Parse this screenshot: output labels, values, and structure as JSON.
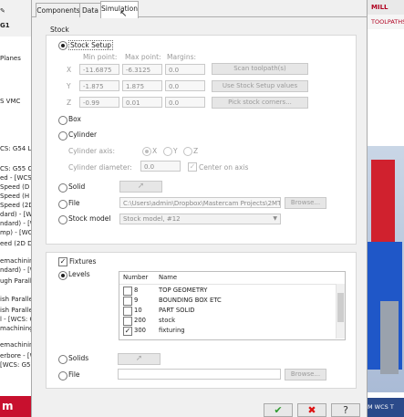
{
  "background": {
    "left_lines": [
      "Planes",
      "S VMC",
      "CS: G54 LEI",
      "CS: G55 CE",
      "ed - [WCS: G",
      "Speed (D",
      "Speed (H",
      "Speed (2D",
      "dard) - [W",
      "ndard) - [W",
      "mp) - [WCS",
      "eed (2D D",
      "emachining",
      "ndard) - [W",
      "ugh Paralle",
      "ish Paralle",
      "ish Paralle",
      "l - [WCS: G",
      "machining)",
      "emachining",
      "erbore - [W",
      "[WCS: G56"
    ],
    "left_top_label": "G1",
    "left_logo": "m",
    "right_top": "MILL",
    "right_sub": "TOOLPATHS",
    "right_bottom": "M WCS  T"
  },
  "tabs": [
    {
      "label": "Components",
      "active": false
    },
    {
      "label": "Data",
      "active": false
    },
    {
      "label": "Simulation",
      "active": true
    }
  ],
  "stock": {
    "section_title": "Stock",
    "stock_setup_label": "Stock Setup",
    "col_min": "Min point:",
    "col_max": "Max point:",
    "col_margins": "Margins:",
    "rows": [
      {
        "axis": "X",
        "min": "-11.6875",
        "max": "-6.3125",
        "margin": "0.0"
      },
      {
        "axis": "Y",
        "min": "-1.875",
        "max": "1.875",
        "margin": "0.0"
      },
      {
        "axis": "Z",
        "min": "-0.99",
        "max": "0.01",
        "margin": "0.0"
      }
    ],
    "scan_button": "Scan toolpath(s)",
    "use_setup_button": "Use Stock Setup values",
    "pick_corners_button": "Pick stock corners...",
    "box_label": "Box",
    "cylinder_label": "Cylinder",
    "cylinder_axis_label": "Cylinder axis:",
    "axis_x": "X",
    "axis_y": "Y",
    "axis_z": "Z",
    "cylinder_diameter_label": "Cylinder diameter:",
    "cylinder_diameter_value": "0.0",
    "center_on_axis_label": "Center on axis",
    "solid_label": "Solid",
    "file_label": "File",
    "file_path": "C:\\Users\\admin\\Dropbox\\Mastercam Projects\\2MT - MC2",
    "browse_label": "Browse...",
    "stock_model_label": "Stock model",
    "stock_model_value": "Stock model, #12"
  },
  "fixtures": {
    "fixtures_label": "Fixtures",
    "levels_label": "Levels",
    "col_number": "Number",
    "col_name": "Name",
    "levels": [
      {
        "number": "8",
        "name": "TOP GEOMETRY",
        "checked": false
      },
      {
        "number": "9",
        "name": "BOUNDING BOX ETC",
        "checked": false
      },
      {
        "number": "10",
        "name": "PART SOLID",
        "checked": false
      },
      {
        "number": "200",
        "name": "stock",
        "checked": false
      },
      {
        "number": "300",
        "name": "fixturing",
        "checked": true
      }
    ],
    "solids_label": "Solids",
    "file_label": "File",
    "file_value": "",
    "browse_label": "Browse..."
  },
  "footer": {
    "ok_icon": "check-icon",
    "cancel_icon": "x-icon",
    "help_icon": "question-icon"
  }
}
